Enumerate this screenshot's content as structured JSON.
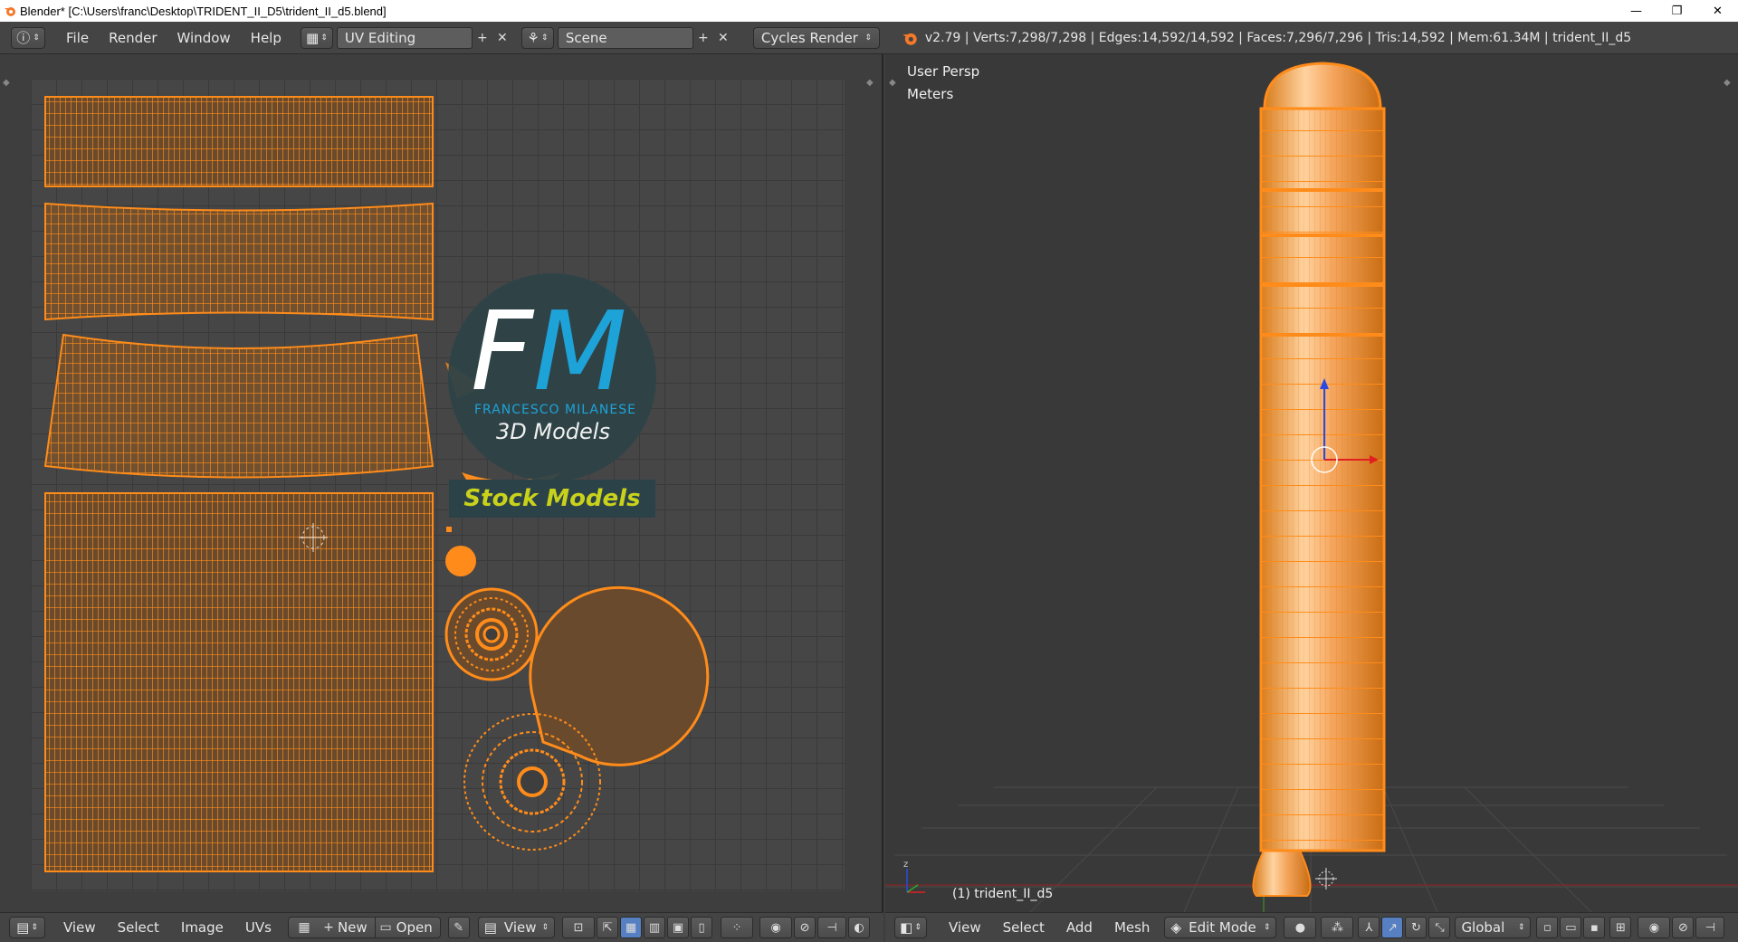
{
  "window": {
    "title": "Blender* [C:\\Users\\franc\\Desktop\\TRIDENT_II_D5\\trident_II_d5.blend]",
    "controls": [
      "—",
      "❐",
      "✕"
    ]
  },
  "infobar": {
    "menus": [
      "File",
      "Render",
      "Window",
      "Help"
    ],
    "screen_layout": "UV Editing",
    "scene": "Scene",
    "render_engine": "Cycles Render",
    "stats": "v2.79 | Verts:7,298/7,298 | Edges:14,592/14,592 | Faces:7,296/7,296 | Tris:14,592 | Mem:61.34M | trident_II_d5"
  },
  "uv_editor": {
    "watermark": {
      "letters_f": "F",
      "letters_m": "M",
      "name": "FRANCESCO MILANESE",
      "tagline": "3D Models",
      "banner": "Stock Models"
    },
    "footer": {
      "menus": [
        "View",
        "Select",
        "Image",
        "UVs"
      ],
      "new_label": "New",
      "open_label": "Open",
      "view_label": "View"
    }
  },
  "viewport": {
    "view_name": "User Persp",
    "units": "Meters",
    "object_label": "(1) trident_II_d5",
    "footer": {
      "menus": [
        "View",
        "Select",
        "Add",
        "Mesh"
      ],
      "mode": "Edit Mode",
      "orientation": "Global"
    }
  },
  "colors": {
    "accent_orange": "#ff8c1a",
    "logo_blue": "#1ea3d8",
    "banner_yellow": "#c9d21a",
    "active_blue": "#5680c2"
  }
}
